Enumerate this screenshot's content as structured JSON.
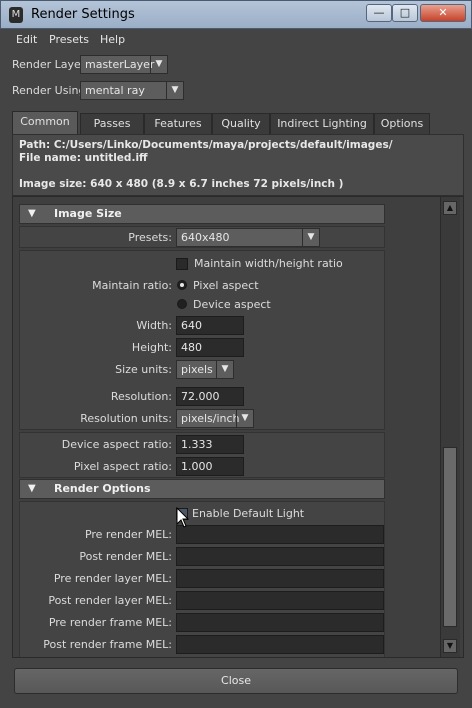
{
  "window": {
    "title": "Render Settings"
  },
  "menu": [
    "Edit",
    "Presets",
    "Help"
  ],
  "render_layer": {
    "label": "Render Layer",
    "value": "masterLayer"
  },
  "render_using": {
    "label": "Render Using",
    "value": "mental ray"
  },
  "tabs": [
    "Common",
    "Passes",
    "Features",
    "Quality",
    "Indirect Lighting",
    "Options"
  ],
  "info": {
    "path": "Path: C:/Users/Linko/Documents/maya/projects/default/images/",
    "file_name": "File name:  untitled.iff",
    "image_size": "Image size: 640 x 480 (8.9 x 6.7 inches 72 pixels/inch )"
  },
  "image_size_section": {
    "title": "Image Size",
    "presets_label": "Presets:",
    "presets_value": "640x480",
    "maintain_wh_label": "Maintain width/height ratio",
    "maintain_ratio_label": "Maintain ratio:",
    "pixel_aspect": "Pixel aspect",
    "device_aspect": "Device aspect",
    "width_label": "Width:",
    "width_value": "640",
    "height_label": "Height:",
    "height_value": "480",
    "size_units_label": "Size units:",
    "size_units_value": "pixels",
    "resolution_label": "Resolution:",
    "resolution_value": "72.000",
    "resolution_units_label": "Resolution units:",
    "resolution_units_value": "pixels/inch",
    "device_aspect_label": "Device aspect ratio:",
    "device_aspect_value": "1.333",
    "pixel_aspect_label": "Pixel aspect ratio:",
    "pixel_aspect_value": "1.000"
  },
  "render_options_section": {
    "title": "Render Options",
    "enable_default_light": "Enable Default Light",
    "pre_render_mel": "Pre render MEL:",
    "post_render_mel": "Post render MEL:",
    "pre_render_layer_mel": "Pre render layer MEL:",
    "post_render_layer_mel": "Post render layer MEL:",
    "pre_render_frame_mel": "Pre render frame MEL:",
    "post_render_frame_mel": "Post render frame MEL:"
  },
  "close_label": "Close"
}
